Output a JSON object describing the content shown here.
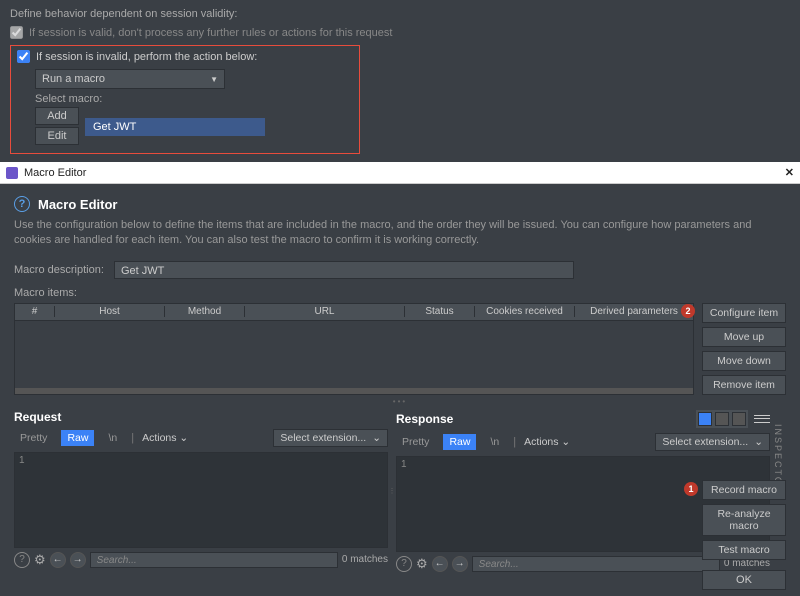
{
  "top": {
    "section_label": "Define behavior dependent on session validity:",
    "check_valid": "If session is valid, don't process any further rules or actions for this request",
    "check_invalid": "If session is invalid, perform the action below:",
    "action_select": "Run a macro",
    "select_macro_label": "Select macro:",
    "add_btn": "Add",
    "edit_btn": "Edit",
    "macro_name": "Get JWT"
  },
  "win": {
    "title": "Macro Editor",
    "heading": "Macro Editor",
    "desc": "Use the configuration below to define the items that are included in the macro, and the order they will be issued. You can configure how parameters and cookies are handled for each item. You can also test the macro to confirm it is working correctly.",
    "macro_desc_label": "Macro description:",
    "macro_desc_value": "Get JWT",
    "macro_items_label": "Macro items:",
    "cols": {
      "n": "#",
      "host": "Host",
      "method": "Method",
      "url": "URL",
      "status": "Status",
      "cookies": "Cookies received",
      "derived": "Derived parameters"
    },
    "side": {
      "configure": "Configure item",
      "moveup": "Move up",
      "movedown": "Move down",
      "remove": "Remove item"
    },
    "req": {
      "title": "Request",
      "pretty": "Pretty",
      "raw": "Raw",
      "n": "\\n",
      "actions": "Actions ⌄",
      "ext": "Select extension...",
      "search_ph": "Search...",
      "matches": "0 matches"
    },
    "res": {
      "title": "Response",
      "pretty": "Pretty",
      "raw": "Raw",
      "n": "\\n",
      "actions": "Actions ⌄",
      "ext": "Select extension...",
      "search_ph": "Search...",
      "matches": "0 matches"
    },
    "inspector": "INSPECTOR",
    "bottom": {
      "record": "Record macro",
      "reanalyze": "Re-analyze macro",
      "test": "Test macro",
      "ok": "OK"
    },
    "badge1": "1",
    "badge2": "2"
  }
}
